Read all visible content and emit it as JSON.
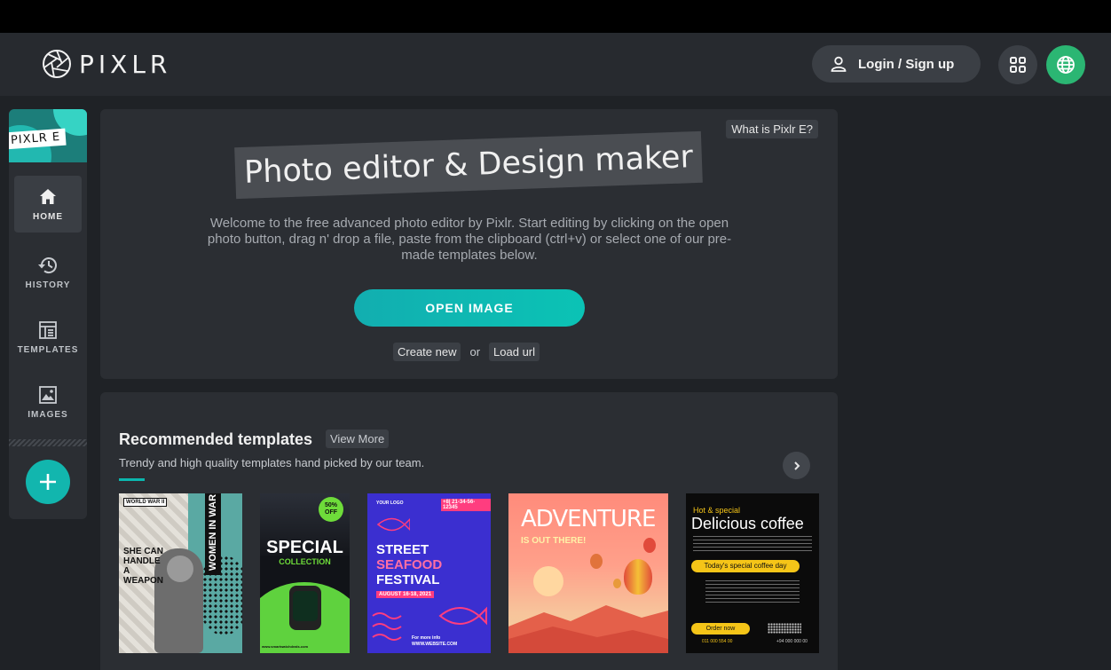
{
  "header": {
    "logo_text": "PIXLR",
    "login_label": "Login / Sign up",
    "apps_icon": "apps-grid-icon",
    "globe_icon": "globe-icon"
  },
  "sidebar": {
    "logo_tag": "PIXLR E",
    "items": [
      {
        "label": "HOME",
        "icon": "home-icon",
        "active": true
      },
      {
        "label": "HISTORY",
        "icon": "history-icon",
        "active": false
      },
      {
        "label": "TEMPLATES",
        "icon": "templates-icon",
        "active": false
      },
      {
        "label": "IMAGES",
        "icon": "image-icon",
        "active": false
      }
    ],
    "add_icon": "plus-icon"
  },
  "hero": {
    "what_label": "What is Pixlr E?",
    "headline": "Photo editor & Design maker",
    "welcome": "Welcome to the free advanced photo editor by Pixlr. Start editing by clicking on the open photo button, drag n' drop a file, paste from the clipboard (ctrl+v) or select one of our pre-made templates below.",
    "open_label": "OPEN IMAGE",
    "create_label": "Create new",
    "or_label": "or",
    "load_label": "Load url"
  },
  "recommended": {
    "title": "Recommended templates",
    "view_more": "View More",
    "subtitle": "Trendy and high quality templates hand picked by our team.",
    "templates": [
      {
        "name": "women-in-war",
        "texts": [
          "WORLD WAR II",
          "SHE CAN HANDLE A WEAPON",
          "WOMEN IN WAR"
        ]
      },
      {
        "name": "special-collection",
        "texts": [
          "50% OFF",
          "SPECIAL",
          "COLLECTION",
          "www.smartwatchdeals.com"
        ]
      },
      {
        "name": "street-seafood-festival",
        "texts": [
          "YOUR LOGO",
          "+8| 21-34-56-12345",
          "STREET",
          "SEAFOOD",
          "FESTIVAL",
          "AUGUST 16-18, 2021",
          "For more info",
          "WWW.WEBSITE.COM"
        ]
      },
      {
        "name": "adventure",
        "texts": [
          "ADVENTURE",
          "IS OUT THERE!"
        ]
      },
      {
        "name": "delicious-coffee",
        "texts": [
          "Hot & special",
          "Delicious coffee",
          "Today's special coffee day",
          "Order now",
          "011 000 554 00",
          "+94 000 000 00"
        ]
      }
    ]
  },
  "colors": {
    "accent": "#12b6ae",
    "globe": "#2bb673",
    "background": "#1f2226",
    "panel": "#2b2e33"
  }
}
